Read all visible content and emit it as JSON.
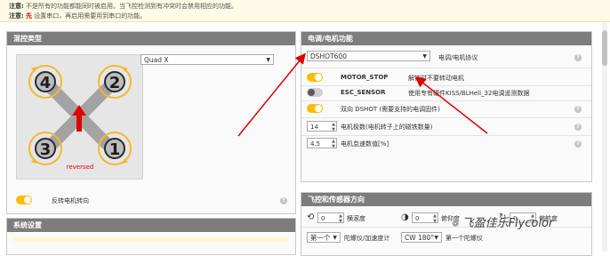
{
  "notice": {
    "line1_prefix": "注意:",
    "line1_text": "不是所有的功能都能同时被启用。当飞控检测到有冲突时会禁用相应的功能。",
    "line2_prefix": "注意:",
    "line2_warn": "先",
    "line2_text": "设置串口，再启用需要用到串口的功能。"
  },
  "mixer": {
    "title": "混控类型",
    "selected": "Quad X",
    "motors": [
      "4",
      "2",
      "3",
      "1"
    ],
    "reversed_label": "reversed",
    "reverse_toggle_label": "反转电机转向",
    "reverse_on": true
  },
  "system": {
    "title": "系统设置"
  },
  "esc": {
    "title": "电调/电机功能",
    "protocol_value": "DSHOT600",
    "protocol_label": "电调/电机协议",
    "features": [
      {
        "name": "MOTOR_STOP",
        "desc": "解锁时不要转动电机",
        "on": true
      },
      {
        "name": "ESC_SENSOR",
        "desc": "使用专有硬件KISS/BLHeli_32电调遥测数据",
        "on": false
      }
    ],
    "bidir_label": "双向 DSHOT (需要支持的电调固件)",
    "bidir_on": true,
    "poles_value": "14",
    "poles_label": "电机极数(电机转子上的磁铁数量)",
    "idle_value": "4.5",
    "idle_label": "电机怠速数值[%]"
  },
  "alignment": {
    "title": "飞控和传感器方向",
    "roll_value": "0",
    "roll_label": "横滚度",
    "pitch_value": "0",
    "pitch_label": "俯仰度",
    "yaw_value": "0",
    "yaw_label": "偏航度",
    "gyro_select": "第一个",
    "gyro_label": "陀螺仪/加速度计",
    "gyro_align_value": "CW 180°",
    "gyro_align_label": "第一个陀螺仪"
  },
  "watermark": "飞盈佳乐Flycolor",
  "colors": {
    "header": "#7d7d7d",
    "toggle_on": "#ffbb00",
    "arrow": "#e00000",
    "prop_ring": "#f5b82e"
  }
}
